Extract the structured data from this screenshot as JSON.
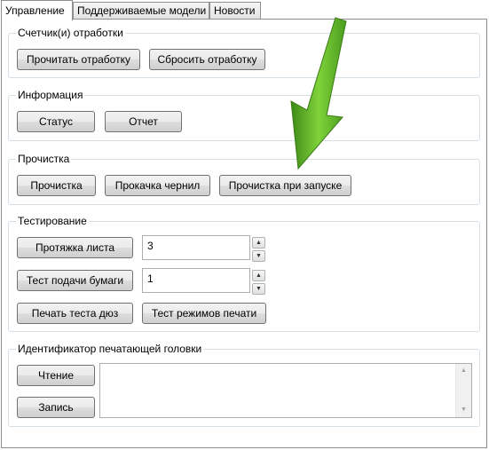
{
  "tabs": [
    {
      "label": "Управление",
      "active": true
    },
    {
      "label": "Поддерживаемые модели",
      "active": false
    },
    {
      "label": "Новости",
      "active": false
    }
  ],
  "counters": {
    "title": "Счетчик(и) отработки",
    "read_label": "Прочитать отработку",
    "reset_label": "Сбросить отработку"
  },
  "info": {
    "title": "Информация",
    "status_label": "Статус",
    "report_label": "Отчет"
  },
  "cleaning": {
    "title": "Прочистка",
    "clean_label": "Прочистка",
    "ink_label": "Прокачка чернил",
    "startup_label": "Прочистка при запуске"
  },
  "testing": {
    "title": "Тестирование",
    "sheet_label": "Протяжка листа",
    "sheet_value": "3",
    "feed_label": "Тест подачи бумаги",
    "feed_value": "1",
    "nozzle_label": "Печать теста дюз",
    "modes_label": "Тест режимов печати"
  },
  "head_id": {
    "title": "Идентификатор печатающей головки",
    "read_label": "Чтение",
    "write_label": "Запись",
    "text_value": ""
  },
  "colors": {
    "accent_arrow": "#5cb52a"
  }
}
